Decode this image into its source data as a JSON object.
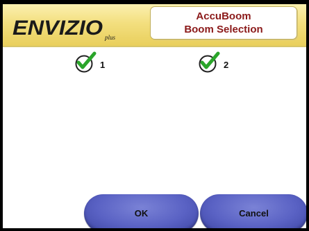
{
  "header": {
    "logo_text": "ENVIZIO",
    "logo_sub": "plus",
    "title_line1": "AccuBoom",
    "title_line2": "Boom Selection"
  },
  "booms": [
    {
      "label": "1",
      "checked": true
    },
    {
      "label": "2",
      "checked": true
    }
  ],
  "buttons": {
    "ok_label": "OK",
    "cancel_label": "Cancel"
  },
  "colors": {
    "header_bg": "#f3df7f",
    "title_text": "#8b1a1a",
    "check_green": "#2aa52a",
    "button_blue": "#5a62c4"
  }
}
